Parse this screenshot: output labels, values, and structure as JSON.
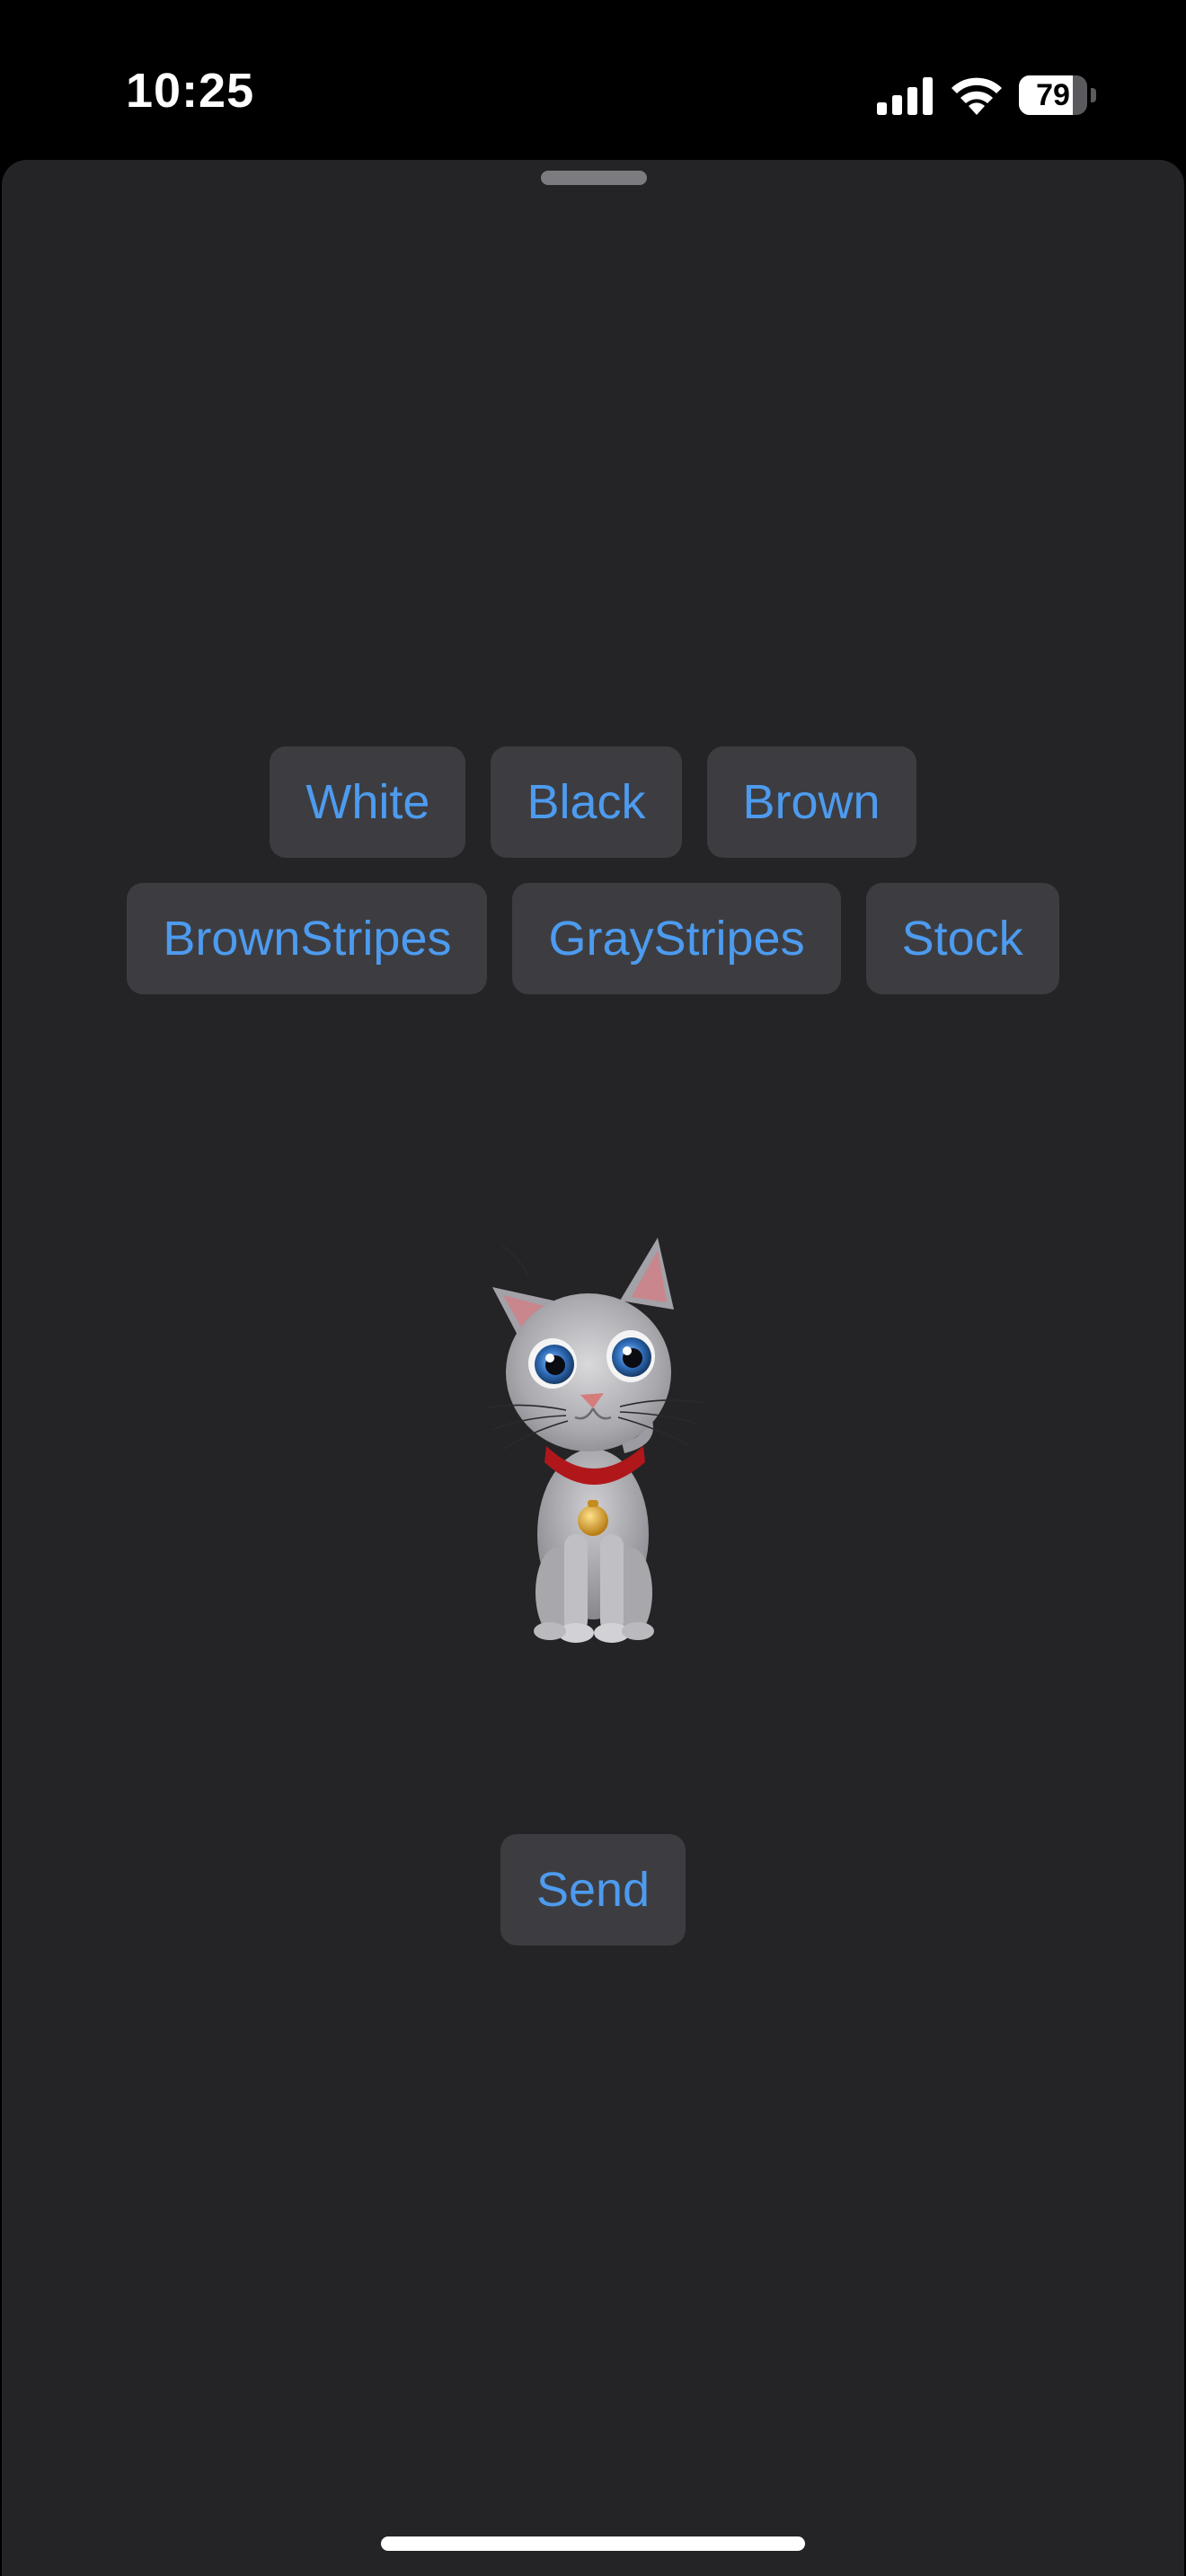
{
  "status_bar": {
    "time": "10:25",
    "battery_level": "79",
    "battery_fraction": 0.79,
    "icons": [
      "signal-icon",
      "wifi-icon",
      "battery-icon"
    ]
  },
  "color_options": {
    "row1": [
      "White",
      "Black",
      "Brown"
    ],
    "row2": [
      "BrownStripes",
      "GrayStripes",
      "Stock"
    ]
  },
  "preview": {
    "subject": "cat-model-image"
  },
  "actions": {
    "send_label": "Send"
  },
  "colors": {
    "background": "#242426",
    "button_bg": "#3d3d41",
    "accent": "#4d9bef",
    "status_bar_bg": "#000000"
  }
}
